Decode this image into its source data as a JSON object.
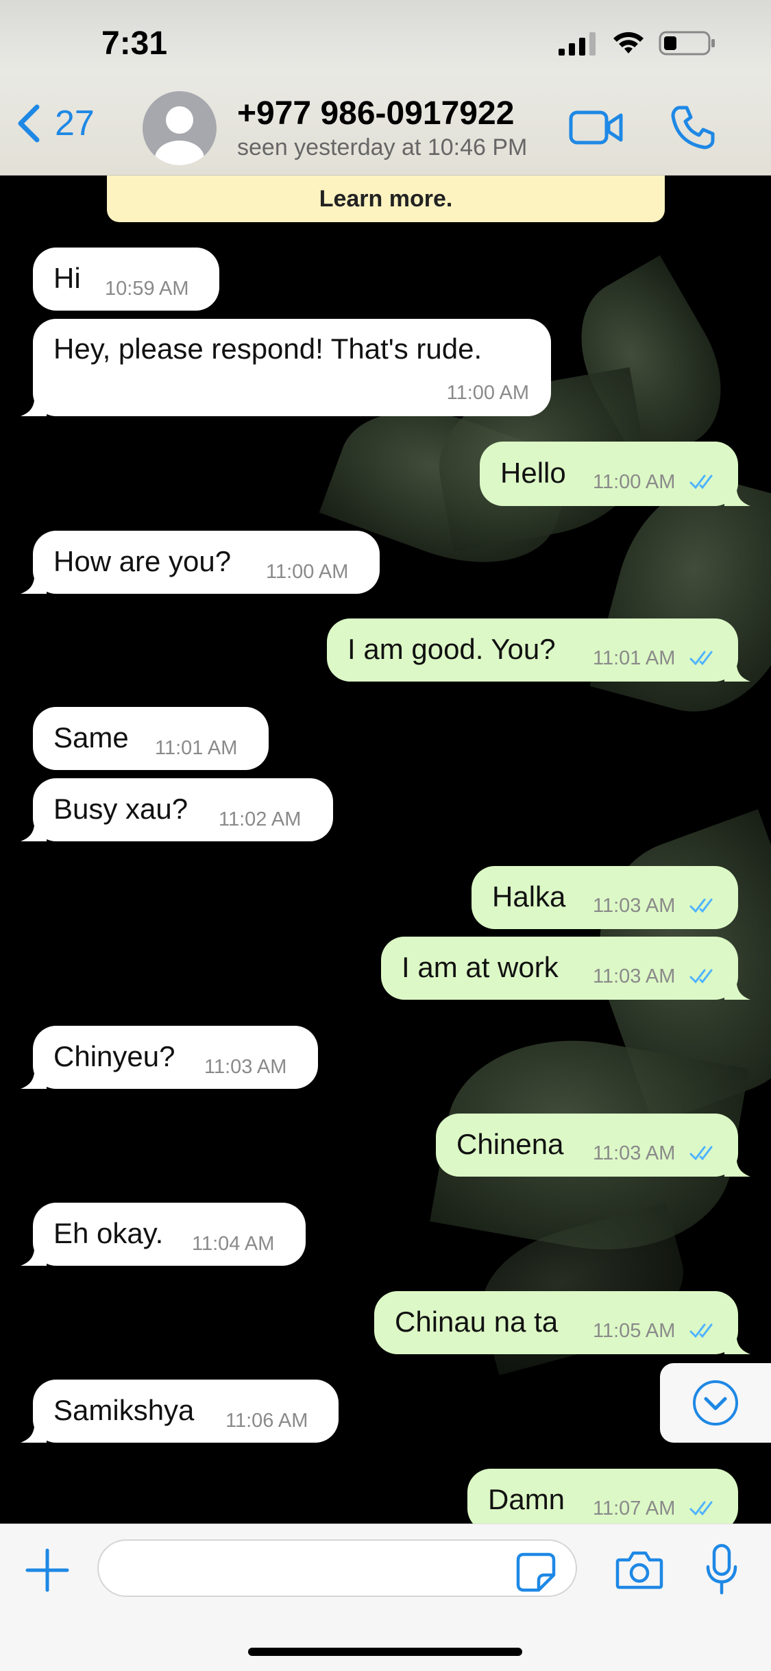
{
  "status_bar": {
    "time": "7:31"
  },
  "header": {
    "back_count": "27",
    "contact_name": "+977 986-0917922",
    "last_seen": "seen yesterday at 10:46 PM"
  },
  "banner": {
    "text": "Learn more."
  },
  "messages": [
    {
      "dir": "in",
      "text": "Hi",
      "time": "10:59 AM"
    },
    {
      "dir": "in",
      "text": "Hey, please respond! That's rude.",
      "time": "11:00 AM"
    },
    {
      "dir": "out",
      "text": "Hello",
      "time": "11:00 AM"
    },
    {
      "dir": "in",
      "text": "How are you?",
      "time": "11:00 AM"
    },
    {
      "dir": "out",
      "text": "I am good. You?",
      "time": "11:01 AM"
    },
    {
      "dir": "in",
      "text": "Same",
      "time": "11:01 AM"
    },
    {
      "dir": "in",
      "text": "Busy xau?",
      "time": "11:02 AM"
    },
    {
      "dir": "out",
      "text": "Halka",
      "time": "11:03 AM"
    },
    {
      "dir": "out",
      "text": "I am at work",
      "time": "11:03 AM"
    },
    {
      "dir": "in",
      "text": "Chinyeu?",
      "time": "11:03 AM"
    },
    {
      "dir": "out",
      "text": "Chinena",
      "time": "11:03 AM"
    },
    {
      "dir": "in",
      "text": "Eh okay.",
      "time": "11:04 AM"
    },
    {
      "dir": "out",
      "text": "Chinau na ta",
      "time": "11:05 AM"
    },
    {
      "dir": "in",
      "text": "Samikshya",
      "time": "11:06 AM"
    },
    {
      "dir": "out",
      "text": "Damn",
      "time": "11:07 AM"
    }
  ],
  "input": {
    "placeholder": ""
  },
  "colors": {
    "accent": "#1e88e5",
    "outgoing_bubble": "#dcf8c6",
    "incoming_bubble": "#ffffff",
    "read_ticks": "#4fb3ff",
    "banner": "#fdf3c0"
  },
  "icons": [
    "back-chevron-icon",
    "video-call-icon",
    "phone-call-icon",
    "scroll-down-icon",
    "plus-icon",
    "sticker-icon",
    "camera-icon",
    "microphone-icon"
  ]
}
